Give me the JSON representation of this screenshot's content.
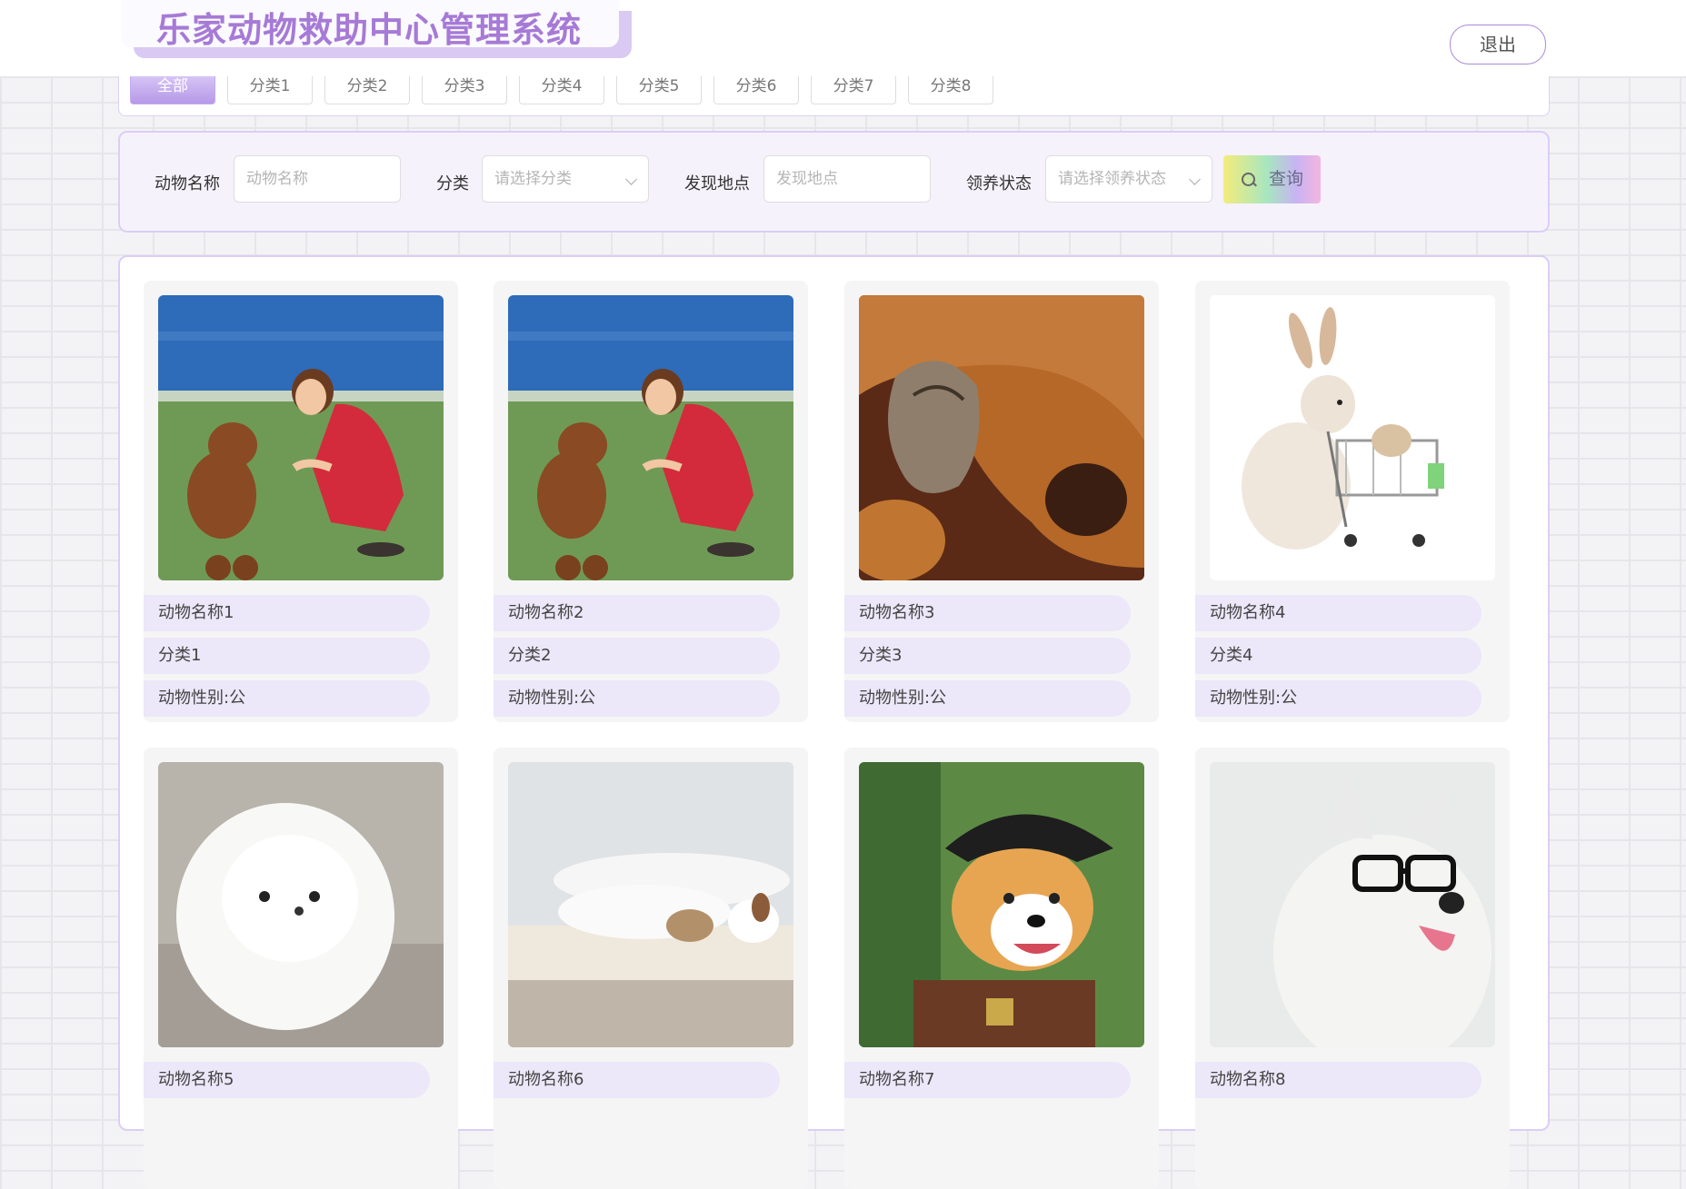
{
  "header": {
    "title": "乐家动物救助中心管理系统",
    "logout_label": "退出"
  },
  "categories": [
    "全部",
    "分类1",
    "分类2",
    "分类3",
    "分类4",
    "分类5",
    "分类6",
    "分类7",
    "分类8"
  ],
  "search": {
    "name_label": "动物名称",
    "name_placeholder": "动物名称",
    "category_label": "分类",
    "category_placeholder": "请选择分类",
    "location_label": "发现地点",
    "location_placeholder": "发现地点",
    "status_label": "领养状态",
    "status_placeholder": "请选择领养状态",
    "query_label": "查询"
  },
  "animals": [
    {
      "name": "动物名称1",
      "category": "分类1",
      "gender": "动物性别:公",
      "image": "woman-with-poodle-photo"
    },
    {
      "name": "动物名称2",
      "category": "分类2",
      "gender": "动物性别:公",
      "image": "woman-with-poodle-photo"
    },
    {
      "name": "动物名称3",
      "category": "分类3",
      "gender": "动物性别:公",
      "image": "kitten-under-bloodhound-photo"
    },
    {
      "name": "动物名称4",
      "category": "分类4",
      "gender": "动物性别:公",
      "image": "rabbit-with-shopping-cart-photo"
    },
    {
      "name": "动物名称5",
      "category": "",
      "gender": "",
      "image": "white-pomeranian-photo"
    },
    {
      "name": "动物名称6",
      "category": "",
      "gender": "",
      "image": "cat-and-dog-sleeping-photo"
    },
    {
      "name": "动物名称7",
      "category": "",
      "gender": "",
      "image": "corgi-pirate-costume-photo"
    },
    {
      "name": "动物名称8",
      "category": "",
      "gender": "",
      "image": "husky-with-glasses-photo"
    }
  ],
  "colors": {
    "accent": "#a67ad6",
    "pill": "#ece7f9",
    "panel_border": "#dccdf6"
  }
}
